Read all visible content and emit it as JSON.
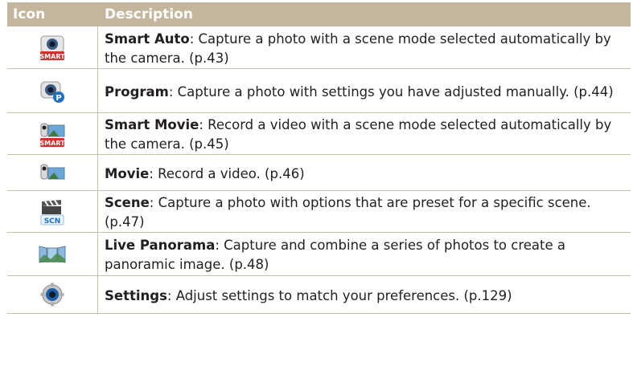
{
  "table": {
    "header": {
      "icon": "Icon",
      "description": "Description"
    },
    "rows": [
      {
        "icon": "smart-auto-icon",
        "name": "Smart Auto",
        "text": ": Capture a photo with a scene mode selected automatically by the camera. (p.43)",
        "badge": "SMART"
      },
      {
        "icon": "program-icon",
        "name": "Program",
        "text": ": Capture a photo with settings you have adjusted manually. (p.44)",
        "badge": "P"
      },
      {
        "icon": "smart-movie-icon",
        "name": "Smart Movie",
        "text": ": Record a video with a scene mode selected automatically by the camera. (p.45)",
        "badge": "SMART"
      },
      {
        "icon": "movie-icon",
        "name": "Movie",
        "text": ": Record a video. (p.46)"
      },
      {
        "icon": "scene-icon",
        "name": "Scene",
        "text": ": Capture a photo with options that are preset for a specific scene. (p.47)",
        "badge": "SCN"
      },
      {
        "icon": "live-panorama-icon",
        "name": "Live Panorama",
        "text": ": Capture and combine a series of photos to create a panoramic image. (p.48)"
      },
      {
        "icon": "settings-icon",
        "name": "Settings",
        "text": ": Adjust settings to match your preferences. (p.129)"
      }
    ]
  },
  "colors": {
    "header_bg": "#c4b69d",
    "rule": "#c9bfad",
    "badge_red": "#d0312d",
    "badge_blue": "#1f6fc0"
  }
}
